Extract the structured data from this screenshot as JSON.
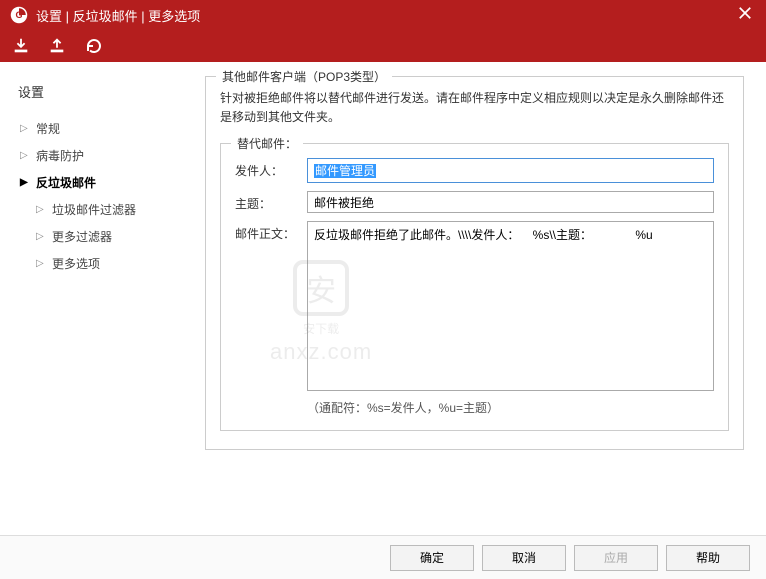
{
  "titlebar": {
    "title": "设置 | 反垃圾邮件 | 更多选项"
  },
  "sidebar": {
    "heading": "设置",
    "items": [
      {
        "label": "常规",
        "expanded": false,
        "active": false
      },
      {
        "label": "病毒防护",
        "expanded": false,
        "active": false
      },
      {
        "label": "反垃圾邮件",
        "expanded": true,
        "active": true,
        "children": [
          {
            "label": "垃圾邮件过滤器"
          },
          {
            "label": "更多过滤器"
          },
          {
            "label": "更多选项"
          }
        ]
      }
    ]
  },
  "content": {
    "group_title": "其他邮件客户端（POP3类型）",
    "description": "针对被拒绝邮件将以替代邮件进行发送。请在邮件程序中定义相应规则以决定是永久删除邮件还是移动到其他文件夹。",
    "inner_group_title": "替代邮件：",
    "fields": {
      "sender_label": "发件人：",
      "sender_value": "邮件管理员",
      "subject_label": "主题：",
      "subject_value": "邮件被拒绝",
      "body_label": "邮件正文：",
      "body_value": "反垃圾邮件拒绝了此邮件。\\\\\\\\发件人：    %s\\\\主题：             %u"
    },
    "hint": "（通配符：%s=发件人，%u=主题）"
  },
  "footer": {
    "ok": "确定",
    "cancel": "取消",
    "apply": "应用",
    "help": "帮助"
  },
  "watermark": {
    "text1": "安下载",
    "text2": "anxz.com"
  }
}
